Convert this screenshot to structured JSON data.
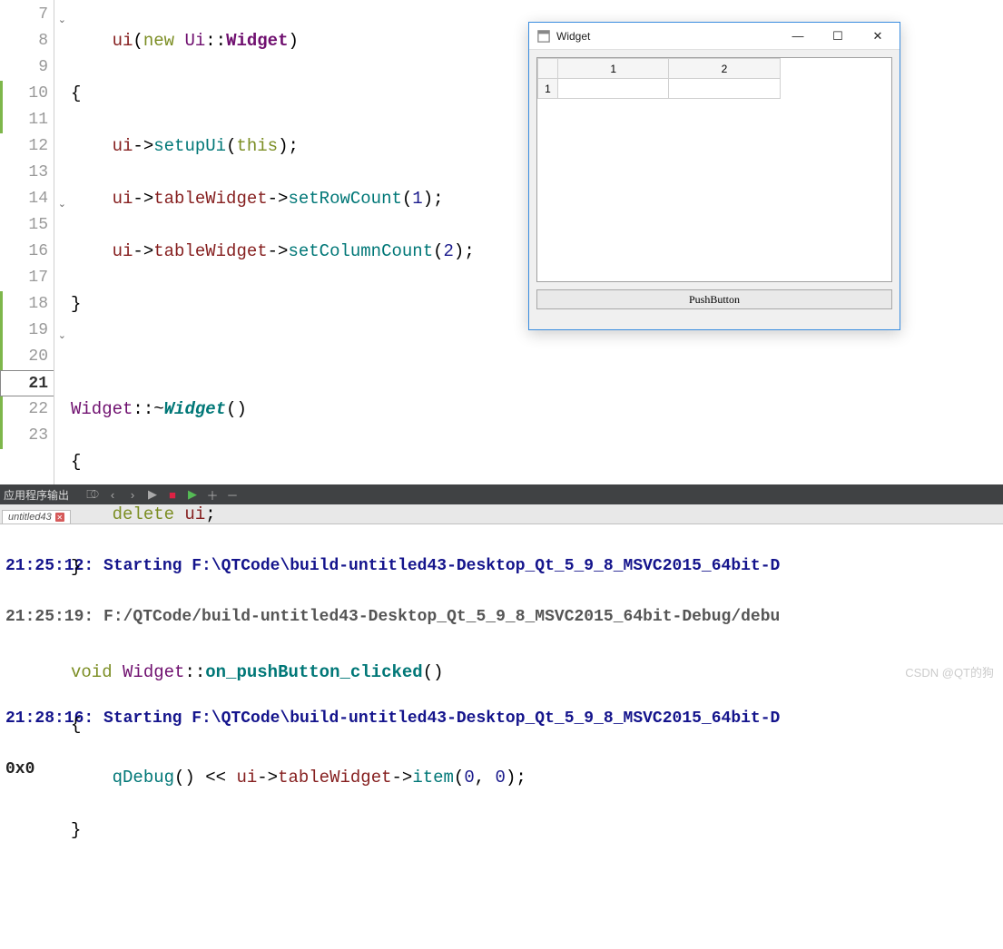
{
  "gutter": {
    "lines": [
      "7",
      "8",
      "9",
      "10",
      "11",
      "12",
      "13",
      "14",
      "15",
      "16",
      "17",
      "18",
      "19",
      "20",
      "21",
      "22",
      "23"
    ],
    "current": "21"
  },
  "code": {
    "l7a": "ui",
    "l7b": "(",
    "l7c": "new",
    "l7d": " Ui",
    "l7e": "::",
    "l7f": "Widget",
    "l7g": ")",
    "l8": "{",
    "l9a": "ui",
    "l9b": "->",
    "l9c": "setupUi",
    "l9d": "(",
    "l9e": "this",
    "l9f": ");",
    "l10a": "ui",
    "l10b": "->",
    "l10c": "tableWidget",
    "l10d": "->",
    "l10e": "setRowCount",
    "l10f": "(",
    "l10g": "1",
    "l10h": ");",
    "l11a": "ui",
    "l11b": "->",
    "l11c": "tableWidget",
    "l11d": "->",
    "l11e": "setColumnCount",
    "l11f": "(",
    "l11g": "2",
    "l11h": ");",
    "l12": "}",
    "l14a": "Widget",
    "l14b": "::~",
    "l14c": "Widget",
    "l14d": "()",
    "l15": "{",
    "l16a": "delete",
    "l16b": " ui",
    "l16c": ";",
    "l17": "}",
    "l19a": "void",
    "l19b": " Widget",
    "l19c": "::",
    "l19d": "on_pushButton_clicked",
    "l19e": "()",
    "l20": "{",
    "l21a": "qDebug",
    "l21b": "() << ",
    "l21c": "ui",
    "l21d": "->",
    "l21e": "tableWidget",
    "l21f": "->",
    "l21g": "item",
    "l21h": "(",
    "l21i": "0",
    "l21j": ", ",
    "l21k": "0",
    "l21l": ");",
    "l22": "}"
  },
  "panel": {
    "title": "应用程序输出",
    "tab": "untitled43"
  },
  "console": {
    "line1": "21:25:12: Starting F:\\QTCode\\build-untitled43-Desktop_Qt_5_9_8_MSVC2015_64bit-D",
    "line2": "21:25:19: F:/QTCode/build-untitled43-Desktop_Qt_5_9_8_MSVC2015_64bit-Debug/debu",
    "line3": "21:28:16: Starting F:\\QTCode\\build-untitled43-Desktop_Qt_5_9_8_MSVC2015_64bit-D",
    "line4": "0x0"
  },
  "appwin": {
    "title": "Widget",
    "col1": "1",
    "col2": "2",
    "row1": "1",
    "button": "PushButton"
  },
  "watermark": "CSDN @QT的狗"
}
